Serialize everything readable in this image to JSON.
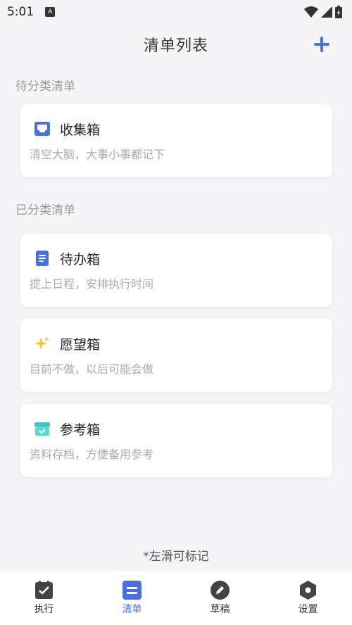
{
  "status_bar": {
    "time": "5:01"
  },
  "header": {
    "title": "清单列表"
  },
  "sections": {
    "uncategorized": "待分类清单",
    "categorized": "已分类清单"
  },
  "cards": [
    {
      "title": "收集箱",
      "desc": "清空大脑，大事小事都记下",
      "icon": "inbox-icon"
    },
    {
      "title": "待办箱",
      "desc": "提上日程，安排执行时间",
      "icon": "document-icon"
    },
    {
      "title": "愿望箱",
      "desc": "目前不做，以后可能会做",
      "icon": "sparkles-icon"
    },
    {
      "title": "参考箱",
      "desc": "资料存档，方便备用参考",
      "icon": "archive-box-icon"
    }
  ],
  "hint": "*左滑可标记",
  "tabs": [
    {
      "label": "执行",
      "icon": "checklist-icon",
      "active": false
    },
    {
      "label": "清单",
      "icon": "list-icon",
      "active": true
    },
    {
      "label": "草稿",
      "icon": "pencil-icon",
      "active": false
    },
    {
      "label": "设置",
      "icon": "hexagon-settings-icon",
      "active": false
    }
  ],
  "colors": {
    "accent": "#4a6fe0",
    "background": "#f5f5f7"
  }
}
